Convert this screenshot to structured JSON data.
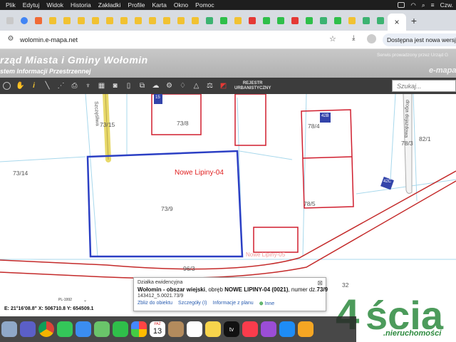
{
  "menubar": {
    "items": [
      "Plik",
      "Edytuj",
      "Widok",
      "Historia",
      "Zakładki",
      "Profile",
      "Karta",
      "Okno",
      "Pomoc"
    ],
    "clock": "Czw."
  },
  "browser": {
    "active_tab_close": "×",
    "new_tab": "+",
    "url": "wolomin.e-mapa.net",
    "update_button": "Dostępna jest nowa wersja"
  },
  "site": {
    "title": "rząd Miasta i Gminy Wołomin",
    "subtitle": "stem Informacji Przestrzennej",
    "service_note": "Serwis prowadzony przez Urząd G",
    "brand": "e-mapa"
  },
  "toolbar": {
    "registry_line1": "REJESTR",
    "registry_line2": "URBANISTYCZNY",
    "search_placeholder": "Szukaj..."
  },
  "map": {
    "place_name": "Nowe Lipiny-04",
    "place_name_faded": "Nowe Lipiny-05",
    "parcels": [
      "73/15",
      "73/8",
      "78/4",
      "73/14",
      "73/9",
      "78/3",
      "82/1",
      "78/5",
      "96/3",
      "32"
    ],
    "road_label": "droga dojazdowa",
    "street_label": "Szczęśliwa",
    "building_labels": [
      "15",
      "42B",
      "42C"
    ],
    "colors": {
      "selected_parcel": "#2b3fc4",
      "buildings": "#d01e2e",
      "road_edge": "#c42a2a",
      "parcel_lines": "#a8d8ec",
      "path": "#e8d96a"
    }
  },
  "popup": {
    "header": "Działka ewidencyjna",
    "close": "⊠",
    "line1_bold": "Wołomin - obszar wiejski",
    "line1_mid": ", obręb ",
    "line1_bold2": "NOWE LIPINY-04 (0021)",
    "line1_end": ", numer dz.",
    "line1_num": "73/9",
    "line2": "143412_5.0021.73/9",
    "links": [
      "Zbliż do obiektu",
      "Szczegóły (I)",
      "Informacje z planu",
      "Inne"
    ]
  },
  "status": {
    "scale": "PL-1992",
    "coords": "E: 21°16'08.8\"  X: 506710.8   Y: 654509.1"
  },
  "watermark": {
    "text": "4ścia",
    "sub": ".nieruchomości"
  },
  "dock": {
    "calendar_month": "PAŹ",
    "calendar_day": "13",
    "tv_label": "tv"
  }
}
